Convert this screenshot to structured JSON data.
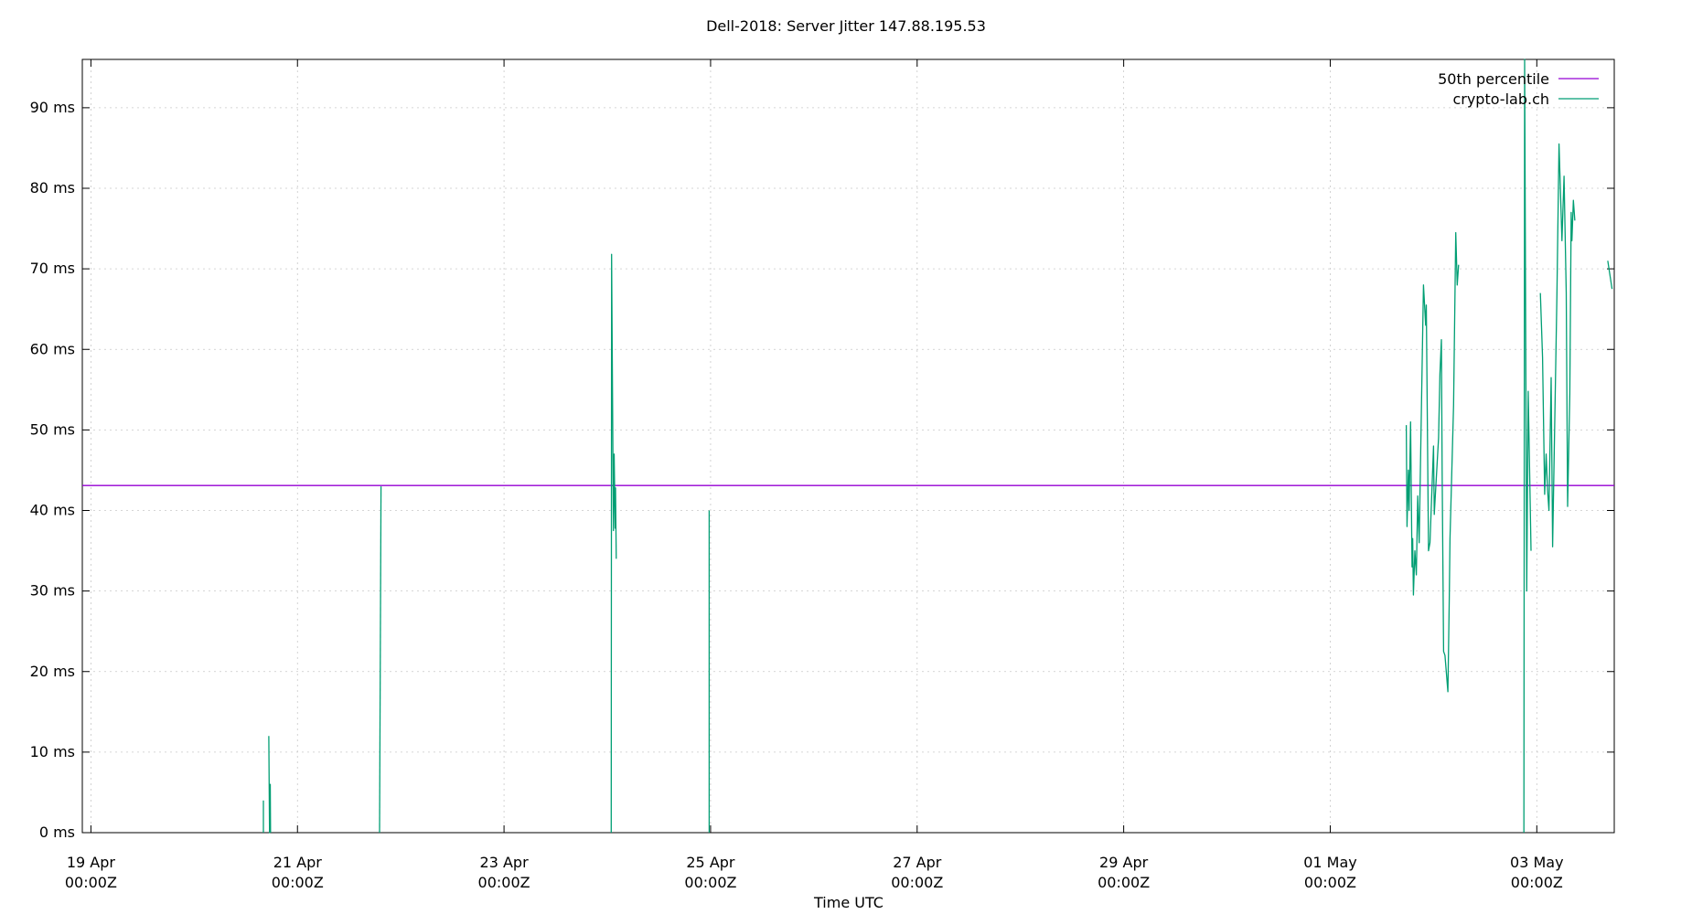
{
  "chart_data": {
    "type": "line",
    "title": "Dell-2018: Server Jitter 147.88.195.53",
    "xlabel": "Time UTC",
    "ylabel": "",
    "x_range": [
      "2024-04-18T22:00Z",
      "2024-05-03T18:00Z"
    ],
    "ylim": [
      0,
      96
    ],
    "yticks": [
      {
        "value": 0,
        "label": "0 ms"
      },
      {
        "value": 10,
        "label": "10 ms"
      },
      {
        "value": 20,
        "label": "20 ms"
      },
      {
        "value": 30,
        "label": "30 ms"
      },
      {
        "value": 40,
        "label": "40 ms"
      },
      {
        "value": 50,
        "label": "50 ms"
      },
      {
        "value": 60,
        "label": "60 ms"
      },
      {
        "value": 70,
        "label": "70 ms"
      },
      {
        "value": 80,
        "label": "80 ms"
      },
      {
        "value": 90,
        "label": "90 ms"
      }
    ],
    "xticks": [
      {
        "value": "2024-04-19T00:00Z",
        "label1": "19 Apr",
        "label2": "00:00Z"
      },
      {
        "value": "2024-04-21T00:00Z",
        "label1": "21 Apr",
        "label2": "00:00Z"
      },
      {
        "value": "2024-04-23T00:00Z",
        "label1": "23 Apr",
        "label2": "00:00Z"
      },
      {
        "value": "2024-04-25T00:00Z",
        "label1": "25 Apr",
        "label2": "00:00Z"
      },
      {
        "value": "2024-04-27T00:00Z",
        "label1": "27 Apr",
        "label2": "00:00Z"
      },
      {
        "value": "2024-04-29T00:00Z",
        "label1": "29 Apr",
        "label2": "00:00Z"
      },
      {
        "value": "2024-05-01T00:00Z",
        "label1": "01 May",
        "label2": "00:00Z"
      },
      {
        "value": "2024-05-03T00:00Z",
        "label1": "03 May",
        "label2": "00:00Z"
      }
    ],
    "grid": true,
    "legend_position": "top-right",
    "series": [
      {
        "name": "50th percentile",
        "color": "#9400d3",
        "points": [
          {
            "x": "2024-04-18T22:00Z",
            "y": 43.1
          },
          {
            "x": "2024-05-03T18:00Z",
            "y": 43.1
          }
        ]
      },
      {
        "name": "crypto-lab.ch",
        "color": "#009e73",
        "segments": [
          [
            {
              "x": "2024-04-20T16:05Z",
              "y": 0
            },
            {
              "x": "2024-04-20T16:05Z",
              "y": 4.0
            }
          ],
          [
            {
              "x": "2024-04-20T17:20Z",
              "y": 12.0
            },
            {
              "x": "2024-04-20T17:30Z",
              "y": 0
            },
            {
              "x": "2024-04-20T17:40Z",
              "y": 6.0
            },
            {
              "x": "2024-04-20T17:45Z",
              "y": 0
            }
          ],
          [
            {
              "x": "2024-04-21T19:05Z",
              "y": 0
            },
            {
              "x": "2024-04-21T19:25Z",
              "y": 43.0
            }
          ],
          [
            {
              "x": "2024-04-24T00:55Z",
              "y": 0
            },
            {
              "x": "2024-04-24T01:00Z",
              "y": 71.8
            },
            {
              "x": "2024-04-24T01:25Z",
              "y": 37.5
            },
            {
              "x": "2024-04-24T01:35Z",
              "y": 47.0
            },
            {
              "x": "2024-04-24T01:50Z",
              "y": 37.8
            },
            {
              "x": "2024-04-24T01:55Z",
              "y": 42.8
            },
            {
              "x": "2024-04-24T02:05Z",
              "y": 34.0
            }
          ],
          [
            {
              "x": "2024-04-24T23:40Z",
              "y": 0
            },
            {
              "x": "2024-04-24T23:40Z",
              "y": 40.0
            }
          ],
          [
            {
              "x": "2024-05-01T17:40Z",
              "y": 50.6
            },
            {
              "x": "2024-05-01T17:50Z",
              "y": 38.0
            },
            {
              "x": "2024-05-01T18:10Z",
              "y": 45.0
            },
            {
              "x": "2024-05-01T18:20Z",
              "y": 40.0
            },
            {
              "x": "2024-05-01T18:40Z",
              "y": 51.0
            },
            {
              "x": "2024-05-01T19:00Z",
              "y": 33.0
            },
            {
              "x": "2024-05-01T19:10Z",
              "y": 36.5
            },
            {
              "x": "2024-05-01T19:20Z",
              "y": 29.5
            },
            {
              "x": "2024-05-01T19:40Z",
              "y": 35.0
            },
            {
              "x": "2024-05-01T20:00Z",
              "y": 32.0
            },
            {
              "x": "2024-05-01T20:20Z",
              "y": 41.8
            },
            {
              "x": "2024-05-01T20:40Z",
              "y": 36.0
            },
            {
              "x": "2024-05-01T21:40Z",
              "y": 68.0
            },
            {
              "x": "2024-05-01T22:10Z",
              "y": 63.0
            },
            {
              "x": "2024-05-01T22:20Z",
              "y": 65.5
            },
            {
              "x": "2024-05-01T22:50Z",
              "y": 35.0
            },
            {
              "x": "2024-05-01T23:10Z",
              "y": 36.0
            },
            {
              "x": "2024-05-02T00:00Z",
              "y": 48.0
            },
            {
              "x": "2024-05-02T00:10Z",
              "y": 39.5
            },
            {
              "x": "2024-05-02T01:10Z",
              "y": 49.0
            },
            {
              "x": "2024-05-02T01:30Z",
              "y": 57.0
            },
            {
              "x": "2024-05-02T01:50Z",
              "y": 61.2
            },
            {
              "x": "2024-05-02T02:00Z",
              "y": 45.0
            },
            {
              "x": "2024-05-02T02:20Z",
              "y": 22.5
            },
            {
              "x": "2024-05-02T02:40Z",
              "y": 22.0
            },
            {
              "x": "2024-05-02T03:20Z",
              "y": 17.5
            },
            {
              "x": "2024-05-02T03:40Z",
              "y": 29.0
            },
            {
              "x": "2024-05-02T03:50Z",
              "y": 36.5
            },
            {
              "x": "2024-05-02T04:40Z",
              "y": 53.0
            },
            {
              "x": "2024-05-02T05:10Z",
              "y": 74.5
            },
            {
              "x": "2024-05-02T05:30Z",
              "y": 68.0
            },
            {
              "x": "2024-05-02T05:50Z",
              "y": 70.5
            }
          ],
          [
            {
              "x": "2024-05-02T21:00Z",
              "y": 0
            },
            {
              "x": "2024-05-02T21:10Z",
              "y": 96.0
            },
            {
              "x": "2024-05-02T21:40Z",
              "y": 30.0
            },
            {
              "x": "2024-05-02T22:00Z",
              "y": 54.8
            },
            {
              "x": "2024-05-02T22:40Z",
              "y": 35.0
            }
          ],
          [
            {
              "x": "2024-05-03T00:50Z",
              "y": 67.0
            },
            {
              "x": "2024-05-03T01:20Z",
              "y": 59.0
            },
            {
              "x": "2024-05-03T01:50Z",
              "y": 42.0
            },
            {
              "x": "2024-05-03T02:10Z",
              "y": 47.0
            },
            {
              "x": "2024-05-03T02:30Z",
              "y": 42.5
            },
            {
              "x": "2024-05-03T02:50Z",
              "y": 40.0
            },
            {
              "x": "2024-05-03T03:20Z",
              "y": 56.5
            },
            {
              "x": "2024-05-03T03:40Z",
              "y": 35.5
            },
            {
              "x": "2024-05-03T04:40Z",
              "y": 66.7
            },
            {
              "x": "2024-05-03T05:10Z",
              "y": 85.5
            },
            {
              "x": "2024-05-03T05:50Z",
              "y": 73.5
            },
            {
              "x": "2024-05-03T06:20Z",
              "y": 81.5
            },
            {
              "x": "2024-05-03T06:50Z",
              "y": 67.0
            },
            {
              "x": "2024-05-03T07:10Z",
              "y": 40.5
            },
            {
              "x": "2024-05-03T07:40Z",
              "y": 54.5
            },
            {
              "x": "2024-05-03T08:00Z",
              "y": 77.0
            },
            {
              "x": "2024-05-03T08:10Z",
              "y": 73.5
            },
            {
              "x": "2024-05-03T08:30Z",
              "y": 78.5
            },
            {
              "x": "2024-05-03T08:50Z",
              "y": 76.0
            }
          ],
          [
            {
              "x": "2024-05-03T16:30Z",
              "y": 71.0
            },
            {
              "x": "2024-05-03T17:30Z",
              "y": 67.5
            }
          ]
        ]
      }
    ]
  }
}
